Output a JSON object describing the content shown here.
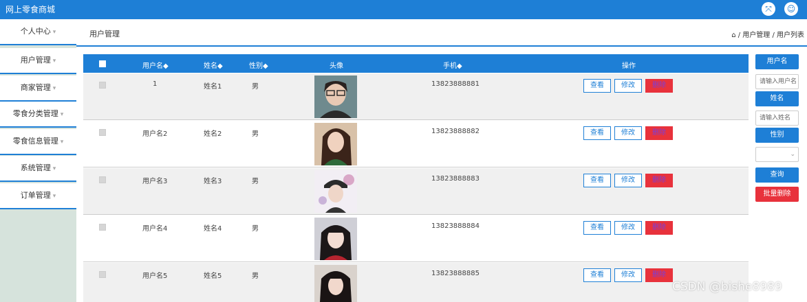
{
  "app": {
    "title": "网上零食商城"
  },
  "topbar": {
    "icon1": "fullscreen-icon",
    "icon2": "user-icon"
  },
  "sidebar": {
    "items": [
      {
        "label": "个人中心"
      },
      {
        "label": "用户管理"
      },
      {
        "label": "商家管理"
      },
      {
        "label": "零食分类管理"
      },
      {
        "label": "零食信息管理"
      },
      {
        "label": "系统管理"
      },
      {
        "label": "订单管理"
      }
    ]
  },
  "header": {
    "page_title": "用户管理",
    "breadcrumb": "⌂ / 用户管理 / 用户列表"
  },
  "table": {
    "columns": {
      "username": "用户名◆",
      "name": "姓名◆",
      "gender": "性别◆",
      "avatar": "头像",
      "phone": "手机◆",
      "actions": "操作"
    },
    "rows": [
      {
        "username": "1",
        "name": "姓名1",
        "gender": "男",
        "phone": "13823888881"
      },
      {
        "username": "用户名2",
        "name": "姓名2",
        "gender": "男",
        "phone": "13823888882"
      },
      {
        "username": "用户名3",
        "name": "姓名3",
        "gender": "男",
        "phone": "13823888883"
      },
      {
        "username": "用户名4",
        "name": "姓名4",
        "gender": "男",
        "phone": "13823888884"
      },
      {
        "username": "用户名5",
        "name": "姓名5",
        "gender": "男",
        "phone": "13823888885"
      }
    ],
    "actions": {
      "view": "查看",
      "edit": "修改",
      "delete": "删除"
    }
  },
  "search_panel": {
    "username_label": "用户名",
    "username_placeholder": "请输入用户名",
    "name_label": "姓名",
    "name_placeholder": "请输入姓名",
    "gender_label": "性别",
    "query_button": "查询",
    "batch_delete_button": "批量删除"
  },
  "watermark": "CSDN @bishe8989",
  "colors": {
    "primary": "#1e7fd6",
    "danger": "#e8323c",
    "sidebar_bg": "#d6e3dc"
  }
}
